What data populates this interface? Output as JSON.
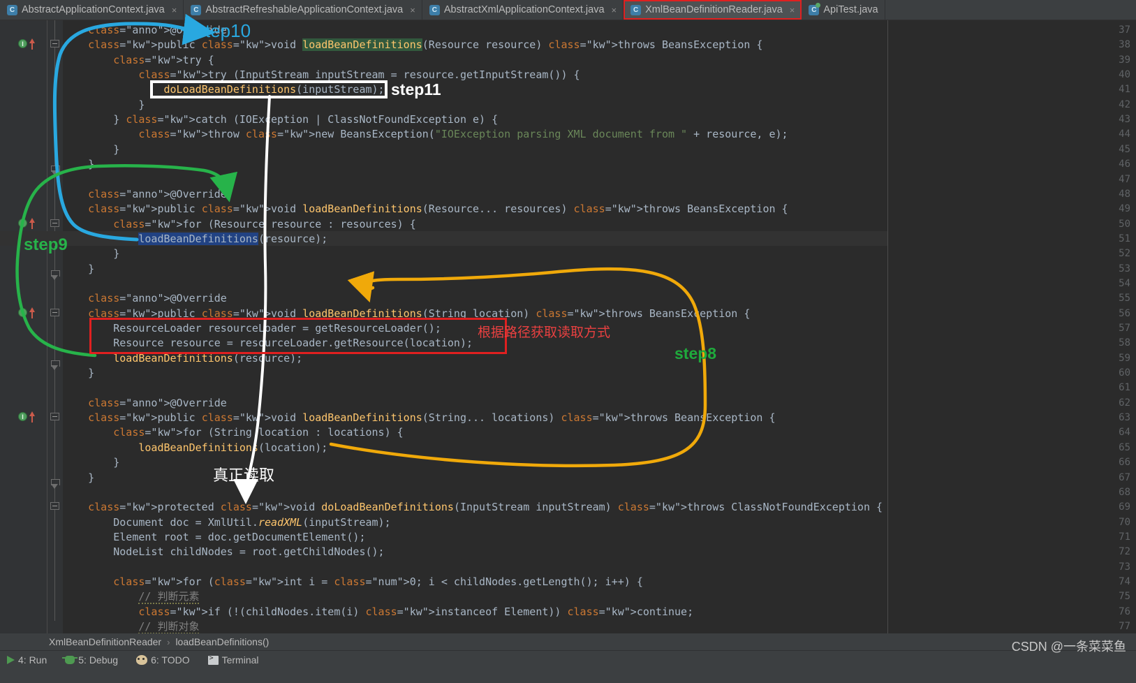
{
  "window": {
    "app": "IntelliJ IDEA",
    "watermark": "CSDN @一条菜菜鱼"
  },
  "tabs": [
    {
      "label": "AbstractApplicationContext.java",
      "icon": "java-class-icon",
      "active": false,
      "close": "×"
    },
    {
      "label": "AbstractRefreshableApplicationContext.java",
      "icon": "java-class-icon",
      "active": false,
      "close": "×"
    },
    {
      "label": "AbstractXmlApplicationContext.java",
      "icon": "java-class-icon",
      "active": false,
      "close": "×"
    },
    {
      "label": "XmlBeanDefinitionReader.java",
      "icon": "java-class-icon",
      "active": true,
      "close": "×"
    },
    {
      "label": "ApiTest.java",
      "icon": "java-runnable-class-icon",
      "active": false,
      "close": ""
    }
  ],
  "editor": {
    "first_line": 37,
    "last_line": 77,
    "lines": [
      {
        "n": 37,
        "text": "    @Override"
      },
      {
        "n": 38,
        "text": "    public void loadBeanDefinitions(Resource resource) throws BeansException {"
      },
      {
        "n": 39,
        "text": "        try {"
      },
      {
        "n": 40,
        "text": "            try (InputStream inputStream = resource.getInputStream()) {"
      },
      {
        "n": 41,
        "text": "                doLoadBeanDefinitions(inputStream);"
      },
      {
        "n": 42,
        "text": "            }"
      },
      {
        "n": 43,
        "text": "        } catch (IOException | ClassNotFoundException e) {"
      },
      {
        "n": 44,
        "text": "            throw new BeansException(\"IOException parsing XML document from \" + resource, e);"
      },
      {
        "n": 45,
        "text": "        }"
      },
      {
        "n": 46,
        "text": "    }"
      },
      {
        "n": 47,
        "text": ""
      },
      {
        "n": 48,
        "text": "    @Override"
      },
      {
        "n": 49,
        "text": "    public void loadBeanDefinitions(Resource... resources) throws BeansException {"
      },
      {
        "n": 50,
        "text": "        for (Resource resource : resources) {"
      },
      {
        "n": 51,
        "text": "            loadBeanDefinitions(resource);"
      },
      {
        "n": 52,
        "text": "        }"
      },
      {
        "n": 53,
        "text": "    }"
      },
      {
        "n": 54,
        "text": ""
      },
      {
        "n": 55,
        "text": "    @Override"
      },
      {
        "n": 56,
        "text": "    public void loadBeanDefinitions(String location) throws BeansException {"
      },
      {
        "n": 57,
        "text": "        ResourceLoader resourceLoader = getResourceLoader();"
      },
      {
        "n": 58,
        "text": "        Resource resource = resourceLoader.getResource(location);"
      },
      {
        "n": 59,
        "text": "        loadBeanDefinitions(resource);"
      },
      {
        "n": 60,
        "text": "    }"
      },
      {
        "n": 61,
        "text": ""
      },
      {
        "n": 62,
        "text": "    @Override"
      },
      {
        "n": 63,
        "text": "    public void loadBeanDefinitions(String... locations) throws BeansException {"
      },
      {
        "n": 64,
        "text": "        for (String location : locations) {"
      },
      {
        "n": 65,
        "text": "            loadBeanDefinitions(location);"
      },
      {
        "n": 66,
        "text": "        }"
      },
      {
        "n": 67,
        "text": "    }"
      },
      {
        "n": 68,
        "text": ""
      },
      {
        "n": 69,
        "text": "    protected void doLoadBeanDefinitions(InputStream inputStream) throws ClassNotFoundException {"
      },
      {
        "n": 70,
        "text": "        Document doc = XmlUtil.readXML(inputStream);"
      },
      {
        "n": 71,
        "text": "        Element root = doc.getDocumentElement();"
      },
      {
        "n": 72,
        "text": "        NodeList childNodes = root.getChildNodes();"
      },
      {
        "n": 73,
        "text": ""
      },
      {
        "n": 74,
        "text": "        for (int i = 0; i < childNodes.getLength(); i++) {"
      },
      {
        "n": 75,
        "text": "            // 判断元素"
      },
      {
        "n": 76,
        "text": "            if (!(childNodes.item(i) instanceof Element)) continue;"
      },
      {
        "n": 77,
        "text": "            // 判断对象"
      }
    ],
    "selected_text": "loadBeanDefinitions",
    "caret_line": 51
  },
  "annotations": [
    {
      "id": "step10",
      "label": "step10",
      "color": "#29a8e0",
      "kind": "arrow-label"
    },
    {
      "id": "step11",
      "label": "step11",
      "color": "#ffffff",
      "kind": "box-label"
    },
    {
      "id": "step9",
      "label": "step9",
      "color": "#27b34a",
      "kind": "arrow-label"
    },
    {
      "id": "step8",
      "label": "step8",
      "color": "#1faa3c",
      "kind": "arrow-label"
    },
    {
      "id": "note-red",
      "label": "根据路径获取读取方式",
      "color": "#e84040",
      "kind": "text-note"
    },
    {
      "id": "note-white",
      "label": "真正读取",
      "color": "#ffffff",
      "kind": "text-note"
    }
  ],
  "breadcrumb": {
    "items": [
      "XmlBeanDefinitionReader",
      "loadBeanDefinitions()"
    ],
    "separator": "›"
  },
  "toolwindows": [
    {
      "label": "4: Run",
      "icon": "run-icon"
    },
    {
      "label": "5: Debug",
      "icon": "debug-icon"
    },
    {
      "label": "6: TODO",
      "icon": "todo-icon"
    },
    {
      "label": "Terminal",
      "icon": "terminal-icon"
    }
  ],
  "colors": {
    "editor_bg": "#2b2b2b",
    "gutter_bg": "#313335",
    "tabbar_bg": "#3c3f41",
    "active_tab_bg": "#4e5254",
    "keyword": "#cc7832",
    "string": "#6a8759",
    "annotation": "#bbb529",
    "method": "#ffc66d",
    "number": "#6897bb",
    "text": "#a9b7c6",
    "selection": "#214283",
    "search_highlight": "#32593d",
    "red_box": "#e02020",
    "blue_arrow": "#29a8e0",
    "green_arrow": "#27b34a",
    "orange_arrow": "#f0a90a",
    "white_arrow": "#ffffff"
  }
}
